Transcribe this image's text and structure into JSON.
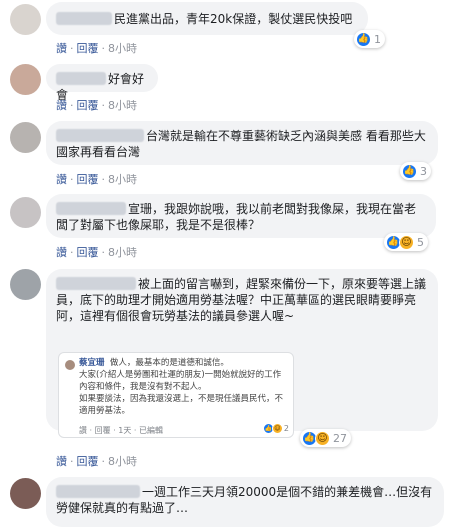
{
  "labels": {
    "like": "讚",
    "reply": "回覆",
    "sep": "·"
  },
  "comments": [
    {
      "text": "民進黨出品，青年20k保證，製仗選民快投吧",
      "time": "8小時",
      "reactions": {
        "count": "1"
      }
    },
    {
      "text": "好會好會",
      "time": "8小時"
    },
    {
      "text": "台灣就是輸在不尊重藝術缺乏內涵與美感 看看那些大國家再看看台灣",
      "time": "8小時",
      "reactions": {
        "count": "3"
      }
    },
    {
      "text": "宣珊，我跟妳說哦，我以前老闆對我像屎，我現在當老闆了對屬下也像屎耶，我是不是很棒？",
      "time": "8小時",
      "reactions": {
        "count": "5"
      }
    },
    {
      "text": "被上面的留言嚇到，趕緊來備份一下，原來要等選上議員，底下的助理才開始適用勞基法喔？中正萬華區的選民眼睛要睜亮阿，這裡有個很會玩勞基法的議員參選人喔~",
      "time": "8小時",
      "reactions": {
        "count": "27"
      },
      "quote": {
        "name": "蔡宜珊",
        "line1": "做人，最基本的是道德和誠信。",
        "line2": "大家(介紹人是勞團和社運的朋友)一開始就說好的工作內容和條件，我是沒有對不起人。",
        "line3": "如果要談法，因為我還沒選上，不是現任議員民代，不適用勞基法。",
        "meta": "讚 · 回覆 · 1天 · 已編輯",
        "count": "2"
      }
    },
    {
      "text": "一週工作三天月領20000是個不錯的兼差機會…但沒有勞健保就真的有點過了…",
      "time": ""
    }
  ],
  "colors": {
    "link": "#385898",
    "bubble": "#f2f3f5",
    "like": "#1877f2",
    "haha": "#f7b125"
  }
}
